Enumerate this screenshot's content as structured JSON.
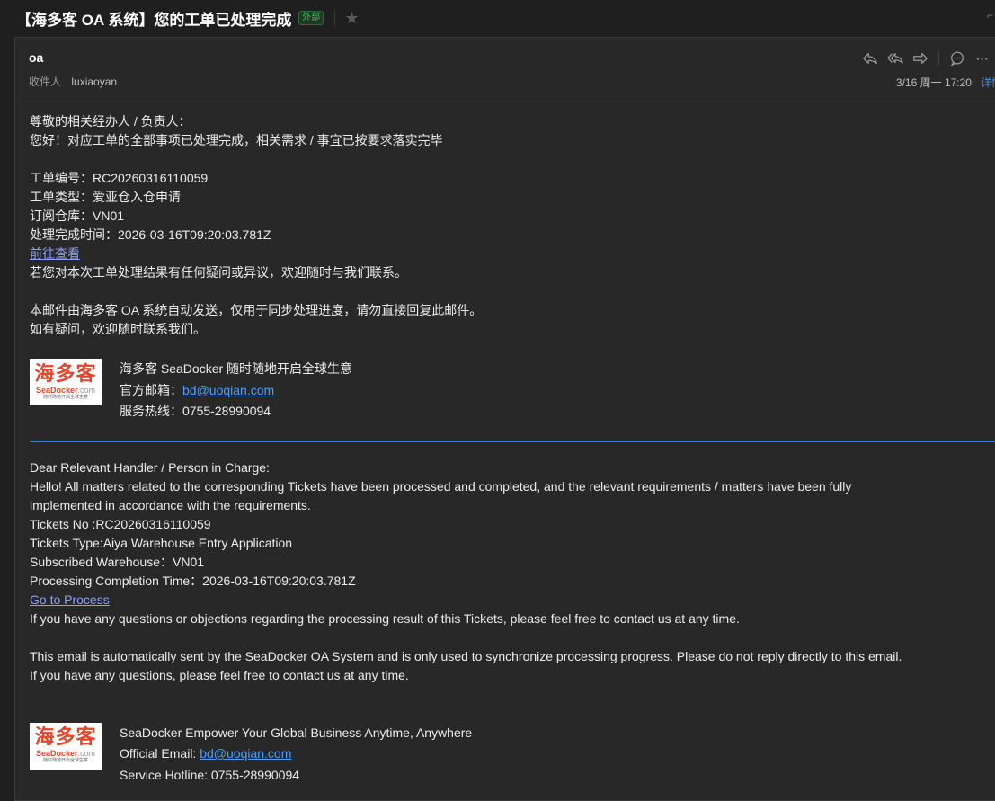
{
  "subject": {
    "title": "【海多客 OA 系统】您的工单已处理完成",
    "external_badge": "外部",
    "top_right_glyph": "⌐"
  },
  "header": {
    "sender": "oa",
    "recipient_label": "收件人",
    "recipient": "luxiaoyan",
    "date": "3/16 周一 17:20",
    "detail_link": "详情",
    "actions": [
      "reply-icon",
      "reply-all-icon",
      "forward-icon",
      "comment-icon",
      "more-icon"
    ],
    "more_glyph": "···"
  },
  "cn": {
    "greeting": "尊敬的相关经办人 / 负责人：",
    "intro": "您好！对应工单的全部事项已处理完成，相关需求 / 事宜已按要求落实完毕",
    "ticket_no": "工单编号：RC20260316110059",
    "ticket_type": "工单类型：爱亚仓入仓申请",
    "warehouse": "订阅仓库：VN01",
    "complete_time": "处理完成时间：2026-03-16T09:20:03.781Z",
    "link": "前往查看",
    "feedback": "若您对本次工单处理结果有任何疑问或异议，欢迎随时与我们联系。",
    "auto_notice": "本邮件由海多客 OA 系统自动发送，仅用于同步处理进度，请勿直接回复此邮件。",
    "contact": "如有疑问，欢迎随时联系我们。",
    "sig_slogan": "海多客 SeaDocker 随时随地开启全球生意",
    "sig_email_label": "官方邮箱：",
    "sig_email": "bd@uoqian.com",
    "sig_hotline": "服务热线：0755-28990094"
  },
  "en": {
    "greeting": "Dear Relevant Handler / Person in Charge:",
    "intro_1": "Hello! All matters related to the corresponding Tickets have been processed and completed, and the relevant requirements / matters have been fully",
    "intro_2": "implemented in accordance with the requirements.",
    "ticket_no": "Tickets No :RC20260316110059",
    "ticket_type": "Tickets Type:Aiya Warehouse Entry Application",
    "warehouse": "Subscribed Warehouse：VN01",
    "complete_time": "Processing Completion Time：2026-03-16T09:20:03.781Z",
    "link": "Go to Process",
    "feedback": "If you have any questions or objections regarding the processing result of this Tickets, please feel free to contact us at any time.",
    "auto_notice": "This email is automatically sent by the SeaDocker OA System and is only used to synchronize processing progress. Please do not reply directly to this email.",
    "contact": "If you have any questions, please feel free to contact us at any time.",
    "sig_slogan": "SeaDocker Empower Your Global Business Anytime, Anywhere",
    "sig_email_label": "Official Email: ",
    "sig_email": "bd@uoqian.com",
    "sig_hotline": "Service Hotline: 0755-28990094"
  },
  "logo": {
    "cn_text": "海多客",
    "en_text": "SeaDocker",
    "en_suffix": ".com",
    "slogan": "随时随地开启全球生意"
  },
  "colors": {
    "accent_blue": "#2f7fd8",
    "link": "#8aa0ff",
    "badge_green": "#3fbf5f",
    "logo_red": "#e3452b"
  }
}
